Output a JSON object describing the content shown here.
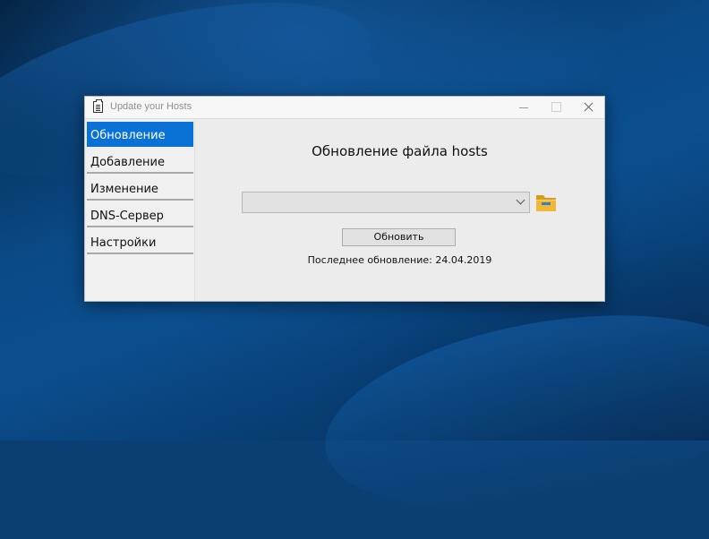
{
  "window": {
    "title": "Update your Hosts"
  },
  "sidebar": {
    "items": [
      {
        "label": "Обновление",
        "active": true
      },
      {
        "label": "Добавление",
        "active": false
      },
      {
        "label": "Изменение",
        "active": false
      },
      {
        "label": "DNS-Сервер",
        "active": false
      },
      {
        "label": "Настройки",
        "active": false
      }
    ]
  },
  "main": {
    "heading": "Обновление файла hosts",
    "source_select": {
      "value": ""
    },
    "update_button_label": "Обновить",
    "last_update_text": "Последнее обновление: 24.04.2019"
  },
  "colors": {
    "accent": "#0a72d6",
    "folder": "#f2b833"
  },
  "icons": {
    "app": "notepad-icon",
    "browse": "folder-icon",
    "dropdown": "chevron-down-icon"
  }
}
